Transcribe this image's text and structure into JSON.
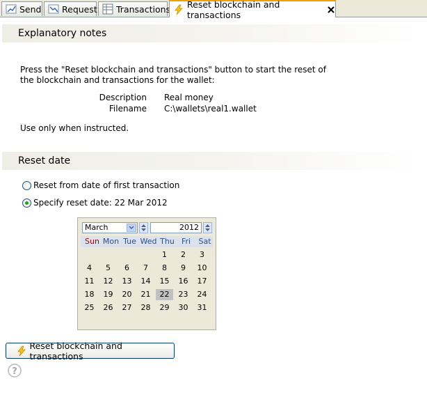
{
  "tabs": [
    {
      "label": "Send",
      "icon": "send-chart-icon"
    },
    {
      "label": "Request",
      "icon": "request-chart-icon"
    },
    {
      "label": "Transactions",
      "icon": "table-icon"
    },
    {
      "label": "Reset blockchain and transactions",
      "icon": "lightning-icon",
      "active": true
    }
  ],
  "explanatory": {
    "heading": "Explanatory notes",
    "line1": "Press the \"Reset blockchain and transactions\" button to start the reset of",
    "line2": "the blockchain and transactions for the wallet:",
    "description_label": "Description",
    "description_value": "Real money",
    "filename_label": "Filename",
    "filename_value": "C:\\wallets\\real1.wallet",
    "note": "Use only when instructed."
  },
  "reset_date": {
    "heading": "Reset date",
    "option_first": "Reset from date of first transaction",
    "option_specify": "Specify reset date: 22 Mar 2012",
    "selected": "specify"
  },
  "calendar": {
    "month": "March",
    "year": "2012",
    "weekdays": [
      "Sun",
      "Mon",
      "Tue",
      "Wed",
      "Thu",
      "Fri",
      "Sat"
    ],
    "weeks": [
      [
        "",
        "",
        "",
        "",
        "1",
        "2",
        "3"
      ],
      [
        "4",
        "5",
        "6",
        "7",
        "8",
        "9",
        "10"
      ],
      [
        "11",
        "12",
        "13",
        "14",
        "15",
        "16",
        "17"
      ],
      [
        "18",
        "19",
        "20",
        "21",
        "22",
        "23",
        "24"
      ],
      [
        "25",
        "26",
        "27",
        "28",
        "29",
        "30",
        "31"
      ]
    ],
    "selected_day": "22"
  },
  "actions": {
    "reset_button": "Reset blockchain and transactions"
  },
  "colors": {
    "accent_tab": "#f0a000",
    "sunday": "#b00000",
    "weekday": "#2b4f8a",
    "radio_dot": "#21a121"
  }
}
